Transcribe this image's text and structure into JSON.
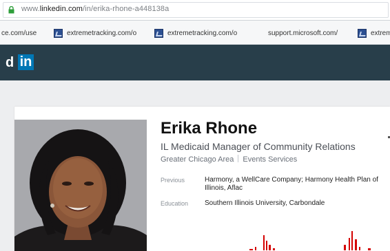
{
  "browser": {
    "url_prefix": "www.",
    "url_domain": "linkedin.com",
    "url_path": "/in/erika-rhone-a448138a",
    "bookmarks": [
      {
        "label": "ce.com/use",
        "icon": "none"
      },
      {
        "label": "extremetracking.com/o",
        "icon": "extremetracking-icon"
      },
      {
        "label": "extremetracking.com/o",
        "icon": "extremetracking-icon"
      },
      {
        "label": "support.microsoft.com/",
        "icon": "microsoft-icon"
      },
      {
        "label": "extrem",
        "icon": "extremetracking-icon"
      }
    ]
  },
  "header": {
    "logo_partial": "d",
    "logo_box": "in"
  },
  "profile": {
    "name": "Erika Rhone",
    "headline": "IL Medicaid Manager of Community Relations",
    "location": "Greater Chicago Area",
    "industry": "Events Services",
    "previous_label": "Previous",
    "previous_value": "Harmony, a WellCare Company; Harmony Health Plan of Illinois, Aflac",
    "education_label": "Education",
    "education_value": "Southern Illinois University, Carbondale"
  },
  "colors": {
    "linkedin_header": "#283e4a",
    "linkedin_blue": "#0077b5",
    "accent_red": "#d40000"
  }
}
